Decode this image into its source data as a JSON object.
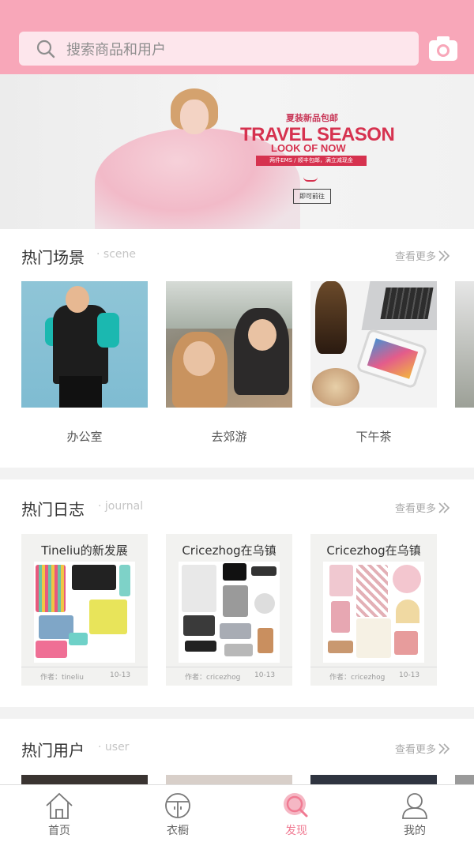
{
  "search": {
    "placeholder": "搜索商品和用户",
    "icon": "search-icon"
  },
  "header": {
    "camera_icon": "camera-icon",
    "accent": "#f8a7b9"
  },
  "banner": {
    "subtitle": "夏装新品包邮",
    "title": "TRAVEL SEASON",
    "title2": "LOOK OF NOW",
    "strip": "两件EMS / 顺丰包邮，满立减现金",
    "button": "即可前往"
  },
  "scene": {
    "title": "热门场景",
    "subtitle": "· scene",
    "more": "查看更多",
    "items": [
      {
        "label": "办公室"
      },
      {
        "label": "去郊游"
      },
      {
        "label": "下午茶"
      }
    ]
  },
  "journal": {
    "title": "热门日志",
    "subtitle": "· journal",
    "more": "查看更多",
    "items": [
      {
        "title": "Tineliu的新发展",
        "author": "作者：tineliu",
        "date": "10-13"
      },
      {
        "title": "Cricezhog在乌镇",
        "author": "作者：cricezhog",
        "date": "10-13"
      },
      {
        "title": "Cricezhog在乌镇",
        "author": "作者：cricezhog",
        "date": "10-13"
      }
    ]
  },
  "users": {
    "title": "热门用户",
    "subtitle": "· user",
    "more": "查看更多"
  },
  "tabbar": {
    "active_color": "#f07a92",
    "tabs": [
      {
        "label": "首页",
        "icon": "home-icon"
      },
      {
        "label": "衣橱",
        "icon": "wardrobe-icon"
      },
      {
        "label": "发现",
        "icon": "discover-icon"
      },
      {
        "label": "我的",
        "icon": "profile-icon"
      }
    ]
  }
}
